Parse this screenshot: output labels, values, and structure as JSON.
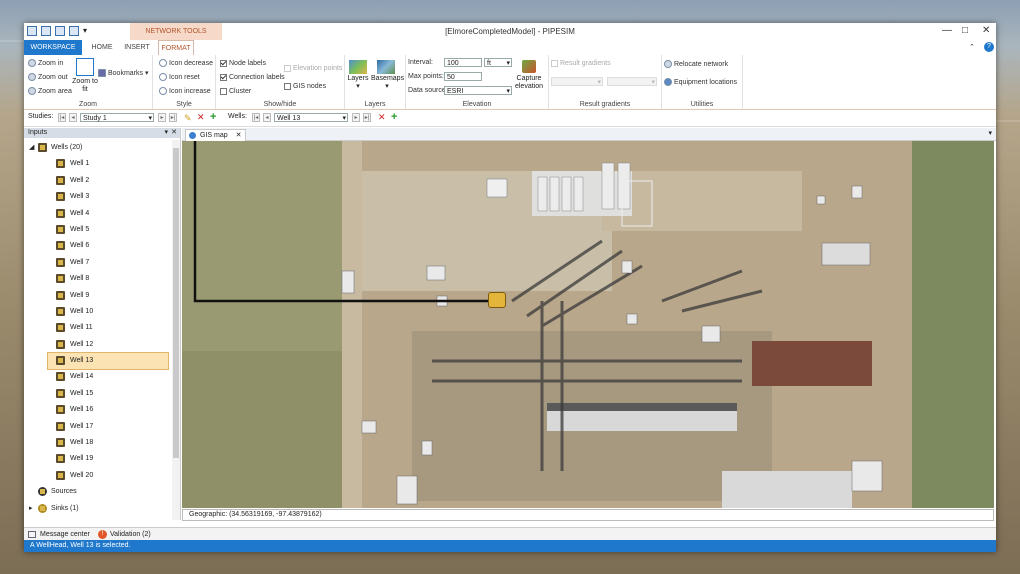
{
  "title_bar": {
    "context_tab": "NETWORK TOOLS",
    "window_title": "[ElmoreCompletedModel] - PIPESIM"
  },
  "ribbon_tabs": {
    "workspace": "WORKSPACE",
    "home": "HOME",
    "insert": "INSERT",
    "format": "FORMAT"
  },
  "ribbon": {
    "zoom": {
      "zoom_in": "Zoom in",
      "zoom_out": "Zoom out",
      "zoom_area": "Zoom area",
      "zoom_to_fit": "Zoom to fit",
      "bookmarks": "Bookmarks",
      "label": "Zoom"
    },
    "style": {
      "icon_decrease": "Icon decrease",
      "icon_reset": "Icon reset",
      "icon_increase": "Icon increase",
      "label": "Style"
    },
    "show_hide": {
      "node_labels": "Node labels",
      "connection_labels": "Connection labels",
      "cluster": "Cluster",
      "elevation_points": "Elevation points",
      "gis_nodes": "GIS nodes",
      "label": "Show/hide"
    },
    "layers": {
      "layers": "Layers",
      "basemaps": "Basemaps",
      "label": "Layers"
    },
    "elevation": {
      "interval_label": "Interval:",
      "interval_value": "100",
      "interval_unit": "ft",
      "max_points_label": "Max points:",
      "max_points_value": "50",
      "data_source_label": "Data source:",
      "data_source_value": "ESRI",
      "capture_elevation": "Capture elevation",
      "label": "Elevation"
    },
    "result_gradients": {
      "result_gradients": "Result gradients",
      "label": "Result gradients"
    },
    "utilities": {
      "relocate_network": "Relocate network",
      "equipment_locations": "Equipment locations",
      "label": "Utilities"
    }
  },
  "study_bar": {
    "studies_label": "Studies:",
    "study_value": "Study 1",
    "wells_label": "Wells:",
    "well_value": "Well 13"
  },
  "inputs_pane": {
    "header": "Inputs",
    "wells_root": "Wells (20)",
    "wells": [
      "Well 1",
      "Well 2",
      "Well 3",
      "Well 4",
      "Well 5",
      "Well 6",
      "Well 7",
      "Well 8",
      "Well 9",
      "Well 10",
      "Well 11",
      "Well 12",
      "Well 13",
      "Well 14",
      "Well 15",
      "Well 16",
      "Well 17",
      "Well 18",
      "Well 19",
      "Well 20"
    ],
    "selected_well": "Well 13",
    "sources": "Sources",
    "sinks": "Sinks (1)"
  },
  "map": {
    "tab_label": "GIS map",
    "coordinates": "Geographic: (34.56319169, -97.43879162)"
  },
  "bottom_tabs": {
    "message_center": "Message center",
    "validation": "Validation (2)"
  },
  "status_message": "A WellHead, Well 13 is selected.",
  "colors": {
    "accent": "#1f78cc",
    "context_tab": "#f7d9c9",
    "selection": "#fbe3b3"
  }
}
